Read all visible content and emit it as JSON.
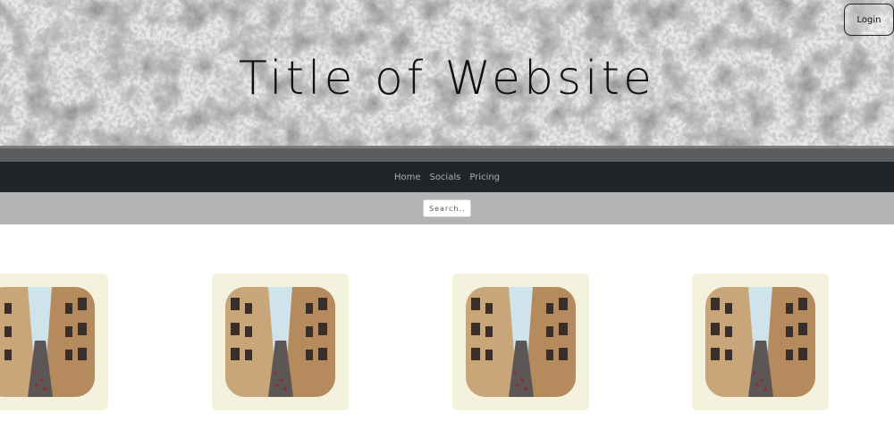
{
  "header": {
    "title": "Title of Website",
    "login_label": "Login"
  },
  "nav": {
    "items": [
      {
        "label": "Home"
      },
      {
        "label": "Socials"
      },
      {
        "label": "Pricing"
      }
    ]
  },
  "search": {
    "placeholder": "Search..."
  },
  "gallery": {
    "cards": [
      {
        "image": "street-photo-icon"
      },
      {
        "image": "street-photo-icon"
      },
      {
        "image": "street-photo-icon"
      },
      {
        "image": "street-photo-icon"
      }
    ]
  },
  "colors": {
    "nav_background": "#212529",
    "search_strip": "#b3b3b3",
    "card_background": "#f4f2dc"
  }
}
